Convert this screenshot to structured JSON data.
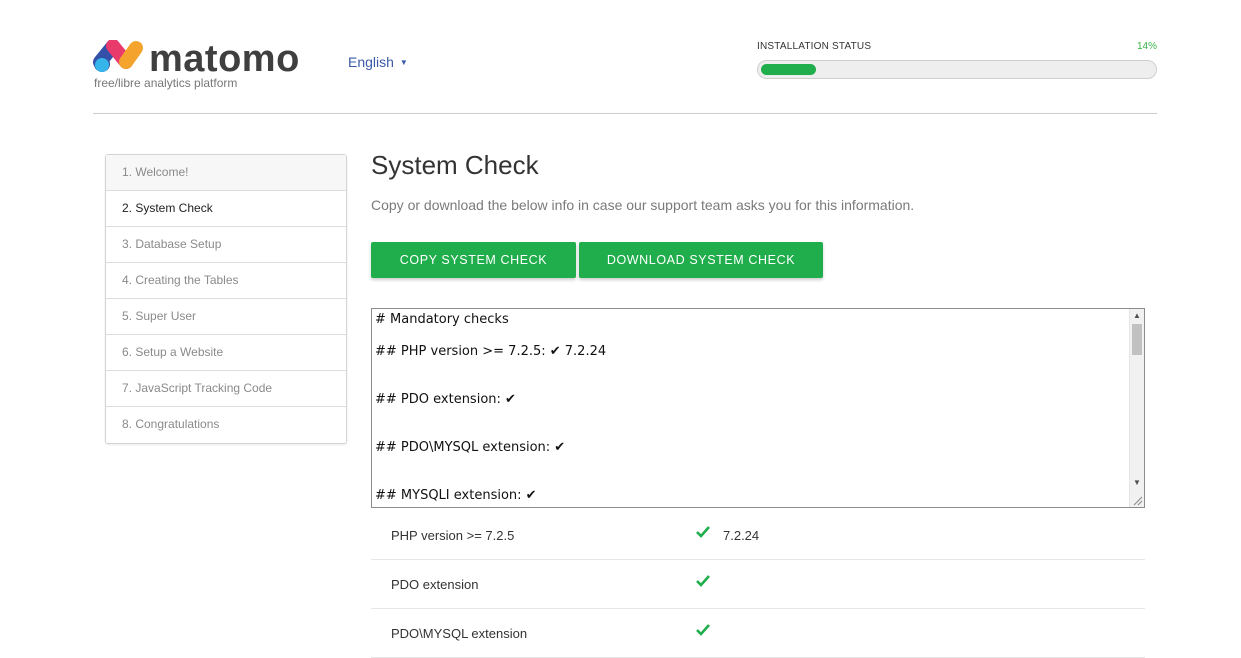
{
  "header": {
    "logo_text": "matomo",
    "tagline": "free/libre analytics platform",
    "language": "English",
    "install_status_label": "INSTALLATION STATUS",
    "install_percent_text": "14%",
    "install_progress": 0.14,
    "accent_color": "#1fae4b"
  },
  "steps": [
    {
      "label": "1. Welcome!",
      "state": "done"
    },
    {
      "label": "2. System Check",
      "state": "current"
    },
    {
      "label": "3. Database Setup",
      "state": "pending"
    },
    {
      "label": "4. Creating the Tables",
      "state": "pending"
    },
    {
      "label": "5. Super User",
      "state": "pending"
    },
    {
      "label": "6. Setup a Website",
      "state": "pending"
    },
    {
      "label": "7. JavaScript Tracking Code",
      "state": "pending"
    },
    {
      "label": "8. Congratulations",
      "state": "pending"
    }
  ],
  "main": {
    "title": "System Check",
    "subtitle": "Copy or download the below info in case our support team asks you for this information.",
    "copy_button": "COPY SYSTEM CHECK",
    "download_button": "DOWNLOAD SYSTEM CHECK",
    "syscheck_lines": [
      "# Mandatory checks",
      "## PHP version >= 7.2.5: ✔ 7.2.24",
      "",
      "## PDO extension: ✔",
      "",
      "## PDO\\MYSQL extension: ✔",
      "",
      "## MYSQLI extension: ✔"
    ],
    "results": [
      {
        "label": "PHP version >= 7.2.5",
        "status": "ok",
        "value": "7.2.24"
      },
      {
        "label": "PDO extension",
        "status": "ok",
        "value": ""
      },
      {
        "label": "PDO\\MYSQL extension",
        "status": "ok",
        "value": ""
      }
    ]
  }
}
